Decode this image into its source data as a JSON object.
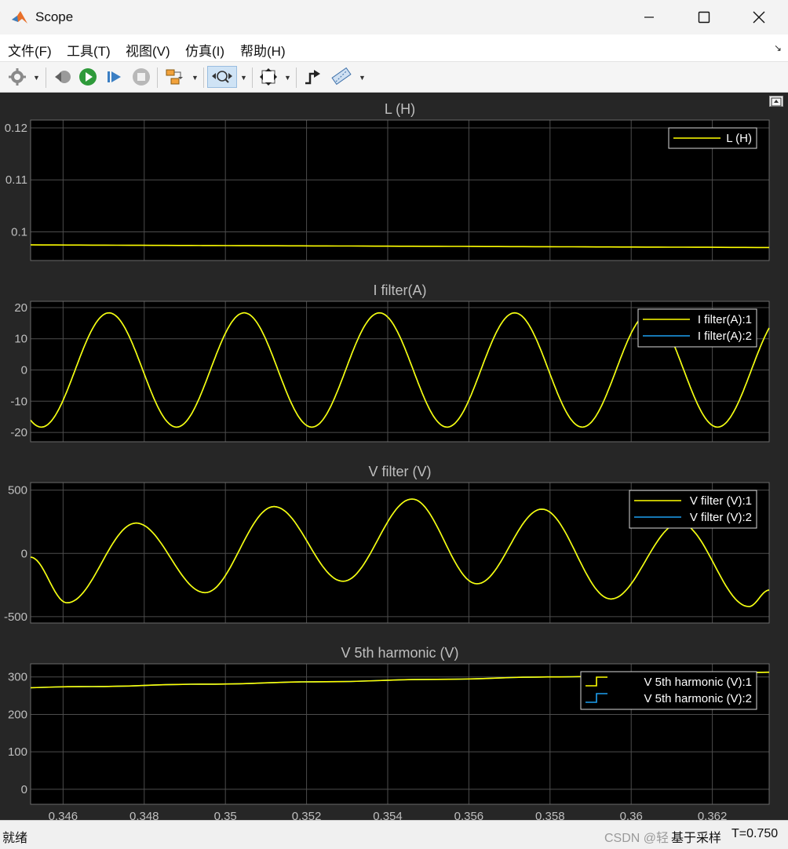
{
  "window": {
    "title": "Scope"
  },
  "menu": [
    {
      "label": "文件(F)"
    },
    {
      "label": "工具(T)"
    },
    {
      "label": "视图(V)"
    },
    {
      "label": "仿真(I)"
    },
    {
      "label": "帮助(H)"
    }
  ],
  "colors": {
    "background": "#000000",
    "panel": "#262626",
    "grid": "#4d4d4d",
    "trace_yellow": "#ffff00",
    "trace_blue": "#1ea0f0",
    "text": "#bfbfbf"
  },
  "status": {
    "left": "就绪",
    "rate": "基于采样",
    "time": "T=0.750",
    "watermark": "CSDN @轻"
  },
  "chart_data": [
    {
      "type": "line",
      "title": "L (H)",
      "x": [
        0.3452,
        0.3634
      ],
      "xlim": [
        0.3452,
        0.3634
      ],
      "ylim": [
        0.0945,
        0.1215
      ],
      "yticks": [
        0.1,
        0.11,
        0.12
      ],
      "yticklabels": [
        "0.1",
        "0.11",
        "0.12"
      ],
      "grid": true,
      "legend": "top-right",
      "series": [
        {
          "name": "L (H)",
          "color": "#ffff00",
          "values": [
            0.0975,
            0.097
          ]
        }
      ]
    },
    {
      "type": "line",
      "title": "I filter(A)",
      "xlim": [
        0.3452,
        0.3634
      ],
      "ylim": [
        -23,
        22
      ],
      "yticks": [
        -20,
        -10,
        0,
        10,
        20
      ],
      "yticklabels": [
        "-20",
        "-10",
        "0",
        "10",
        "20"
      ],
      "grid": true,
      "legend": "top-right",
      "series": [
        {
          "name": "I filter(A):1",
          "color": "#ffff00",
          "amplitude": 18.3,
          "period": 0.003333,
          "peak_x": 0.34713
        },
        {
          "name": "I filter(A):2",
          "color": "#1ea0f0",
          "amplitude": 18.3,
          "period": 0.003333,
          "peak_x": 0.34713
        }
      ]
    },
    {
      "type": "line",
      "title": "V filter (V)",
      "xlim": [
        0.3452,
        0.3634
      ],
      "ylim": [
        -550,
        560
      ],
      "yticks": [
        -500,
        0,
        500
      ],
      "yticklabels": [
        "-500",
        "0",
        "500"
      ],
      "grid": true,
      "legend": "top-right",
      "series": [
        {
          "name": "V filter (V):1",
          "color": "#ffff00",
          "points": [
            [
              0.3452,
              -30
            ],
            [
              0.3461,
              -390
            ],
            [
              0.3478,
              240
            ],
            [
              0.3495,
              -310
            ],
            [
              0.3512,
              370
            ],
            [
              0.3529,
              -220
            ],
            [
              0.3546,
              430
            ],
            [
              0.3562,
              -240
            ],
            [
              0.3578,
              350
            ],
            [
              0.3595,
              -360
            ],
            [
              0.3612,
              240
            ],
            [
              0.3629,
              -420
            ],
            [
              0.3634,
              -290
            ]
          ]
        },
        {
          "name": "V filter (V):2",
          "color": "#1ea0f0",
          "points": [
            [
              0.3452,
              -30
            ],
            [
              0.3461,
              -390
            ],
            [
              0.3478,
              240
            ],
            [
              0.3495,
              -310
            ],
            [
              0.3512,
              370
            ],
            [
              0.3529,
              -220
            ],
            [
              0.3546,
              430
            ],
            [
              0.3562,
              -240
            ],
            [
              0.3578,
              350
            ],
            [
              0.3595,
              -360
            ],
            [
              0.3612,
              240
            ],
            [
              0.3629,
              -420
            ],
            [
              0.3634,
              -290
            ]
          ]
        }
      ]
    },
    {
      "type": "line",
      "title": "V 5th harmonic (V)",
      "xlim": [
        0.3452,
        0.3634
      ],
      "ylim": [
        -40,
        335
      ],
      "yticks": [
        0,
        100,
        200,
        300
      ],
      "yticklabels": [
        "0",
        "100",
        "200",
        "300"
      ],
      "xticks": [
        0.346,
        0.348,
        0.35,
        0.352,
        0.354,
        0.356,
        0.358,
        0.36,
        0.362
      ],
      "xticklabels": [
        "0.346",
        "0.348",
        "0.35",
        "0.352",
        "0.354",
        "0.356",
        "0.358",
        "0.36",
        "0.362"
      ],
      "grid": true,
      "legend": "top-right",
      "series": [
        {
          "name": "V 5th harmonic (V):1",
          "color": "#ffff00",
          "values": [
            271,
            312
          ]
        },
        {
          "name": "V 5th harmonic (V):2",
          "color": "#1ea0f0",
          "values": [
            271,
            312
          ]
        }
      ]
    }
  ]
}
